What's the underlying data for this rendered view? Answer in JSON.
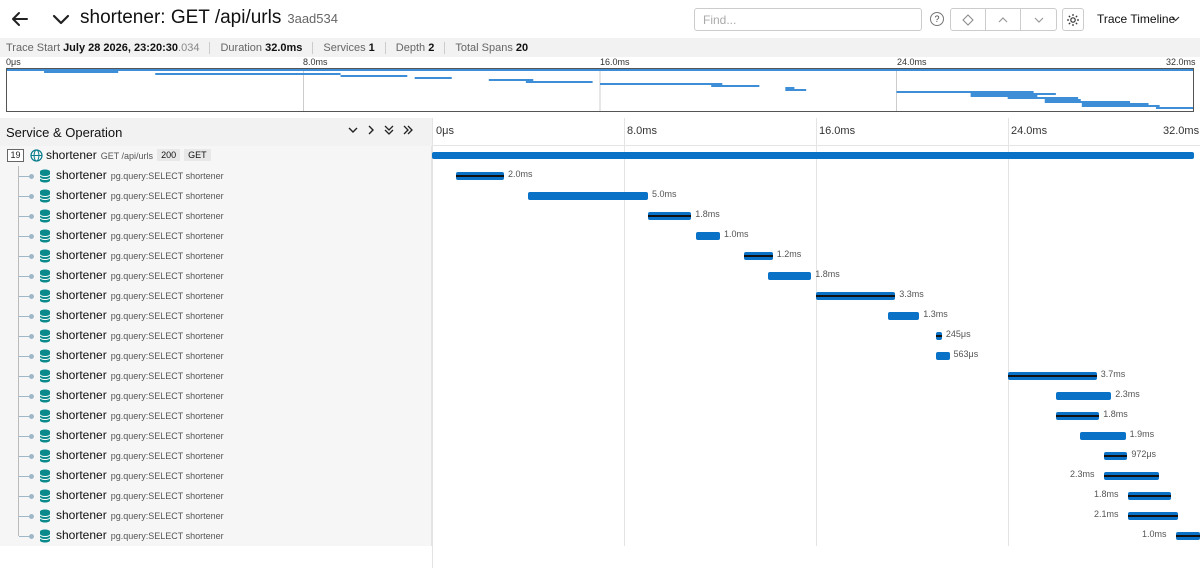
{
  "header": {
    "title": "shortener: GET /api/urls",
    "trace_id": "3aad534",
    "find_placeholder": "Find...",
    "help": "?",
    "view_label": "Trace Timeline"
  },
  "summary": {
    "trace_start_label": "Trace Start",
    "trace_start_date": "July 28 2026, 23:20:30",
    "trace_start_ms": ".034",
    "duration_label": "Duration",
    "duration": "32.0ms",
    "services_label": "Services",
    "services": "1",
    "depth_label": "Depth",
    "depth": "2",
    "spans_label": "Total Spans",
    "spans": "20"
  },
  "ticks": [
    "0μs",
    "8.0ms",
    "16.0ms",
    "24.0ms",
    "32.0ms"
  ],
  "panel": {
    "title": "Service & Operation"
  },
  "root": {
    "count": "19",
    "service": "shortener",
    "operation": "GET /api/urls",
    "status": "200",
    "method": "GET"
  },
  "spans": [
    {
      "service": "shortener",
      "op": "pg.query:SELECT shortener",
      "label": "2.0ms",
      "start": 1.0,
      "dur": 2.0
    },
    {
      "service": "shortener",
      "op": "pg.query:SELECT shortener",
      "label": "5.0ms",
      "start": 4.0,
      "dur": 5.0
    },
    {
      "service": "shortener",
      "op": "pg.query:SELECT shortener",
      "label": "1.8ms",
      "start": 9.0,
      "dur": 1.8
    },
    {
      "service": "shortener",
      "op": "pg.query:SELECT shortener",
      "label": "1.0ms",
      "start": 11.0,
      "dur": 1.0
    },
    {
      "service": "shortener",
      "op": "pg.query:SELECT shortener",
      "label": "1.2ms",
      "start": 13.0,
      "dur": 1.2
    },
    {
      "service": "shortener",
      "op": "pg.query:SELECT shortener",
      "label": "1.8ms",
      "start": 14.0,
      "dur": 1.8
    },
    {
      "service": "shortener",
      "op": "pg.query:SELECT shortener",
      "label": "3.3ms",
      "start": 16.0,
      "dur": 3.3
    },
    {
      "service": "shortener",
      "op": "pg.query:SELECT shortener",
      "label": "1.3ms",
      "start": 19.0,
      "dur": 1.3
    },
    {
      "service": "shortener",
      "op": "pg.query:SELECT shortener",
      "label": "245μs",
      "start": 21.0,
      "dur": 0.245
    },
    {
      "service": "shortener",
      "op": "pg.query:SELECT shortener",
      "label": "563μs",
      "start": 21.0,
      "dur": 0.563
    },
    {
      "service": "shortener",
      "op": "pg.query:SELECT shortener",
      "label": "3.7ms",
      "start": 24.0,
      "dur": 3.7
    },
    {
      "service": "shortener",
      "op": "pg.query:SELECT shortener",
      "label": "2.3ms",
      "start": 26.0,
      "dur": 2.3
    },
    {
      "service": "shortener",
      "op": "pg.query:SELECT shortener",
      "label": "1.8ms",
      "start": 26.0,
      "dur": 1.8
    },
    {
      "service": "shortener",
      "op": "pg.query:SELECT shortener",
      "label": "1.9ms",
      "start": 27.0,
      "dur": 1.9
    },
    {
      "service": "shortener",
      "op": "pg.query:SELECT shortener",
      "label": "972μs",
      "start": 28.0,
      "dur": 0.972
    },
    {
      "service": "shortener",
      "op": "pg.query:SELECT shortener",
      "label": "2.3ms",
      "start": 28.0,
      "dur": 2.3
    },
    {
      "service": "shortener",
      "op": "pg.query:SELECT shortener",
      "label": "1.8ms",
      "start": 29.0,
      "dur": 1.8
    },
    {
      "service": "shortener",
      "op": "pg.query:SELECT shortener",
      "label": "2.1ms",
      "start": 29.0,
      "dur": 2.1
    },
    {
      "service": "shortener",
      "op": "pg.query:SELECT shortener",
      "label": "1.0ms",
      "start": 31.0,
      "dur": 1.0
    }
  ],
  "colors": {
    "span": "#0a72c6",
    "minimap_span": "#3d8ed6",
    "critical_path": "#111111"
  }
}
